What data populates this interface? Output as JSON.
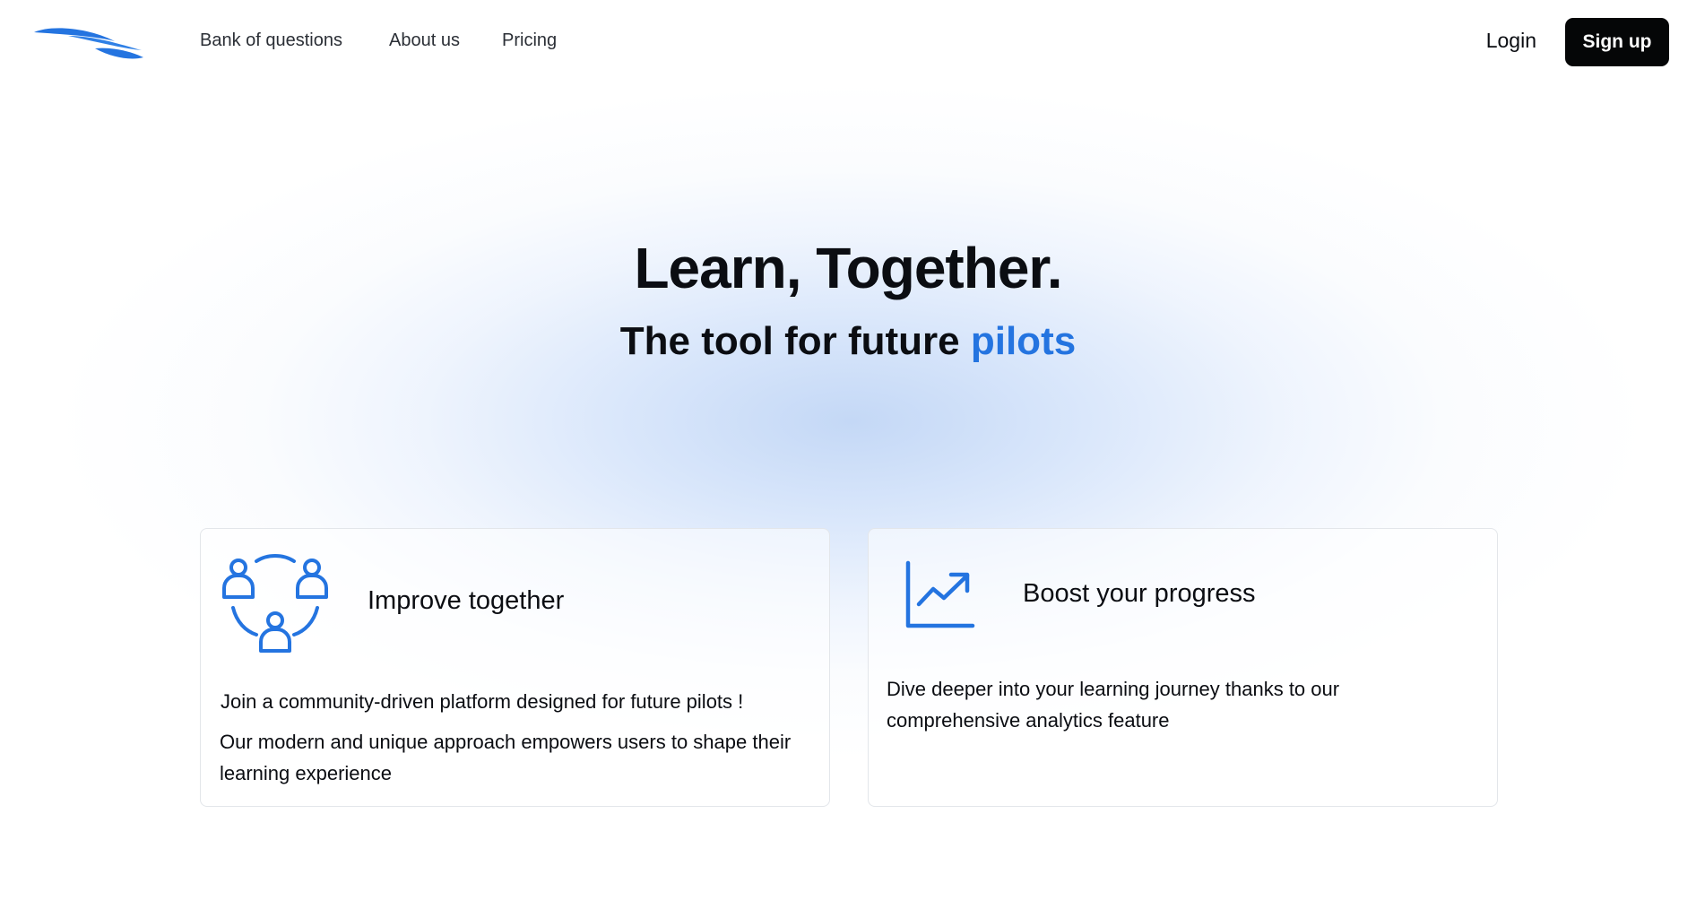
{
  "brand": {
    "logo_icon": "wing-swoosh-logo-icon",
    "accent_color": "#2474e0"
  },
  "nav": {
    "links": [
      {
        "label": "Bank of questions"
      },
      {
        "label": "About us"
      },
      {
        "label": "Pricing"
      }
    ],
    "login_label": "Login",
    "signup_label": "Sign up"
  },
  "hero": {
    "title": "Learn, Together.",
    "subtitle_prefix": "The tool for future ",
    "subtitle_highlight": "pilots"
  },
  "features": [
    {
      "icon": "community-people-icon",
      "title": "Improve together",
      "paragraphs": [
        "Join a community-driven platform designed for future pilots !",
        "Our modern and unique approach empowers users to shape their learning experience"
      ]
    },
    {
      "icon": "trending-chart-icon",
      "title": "Boost your progress",
      "paragraphs": [
        "Dive deeper into your learning journey thanks to our comprehensive analytics feature"
      ]
    }
  ]
}
